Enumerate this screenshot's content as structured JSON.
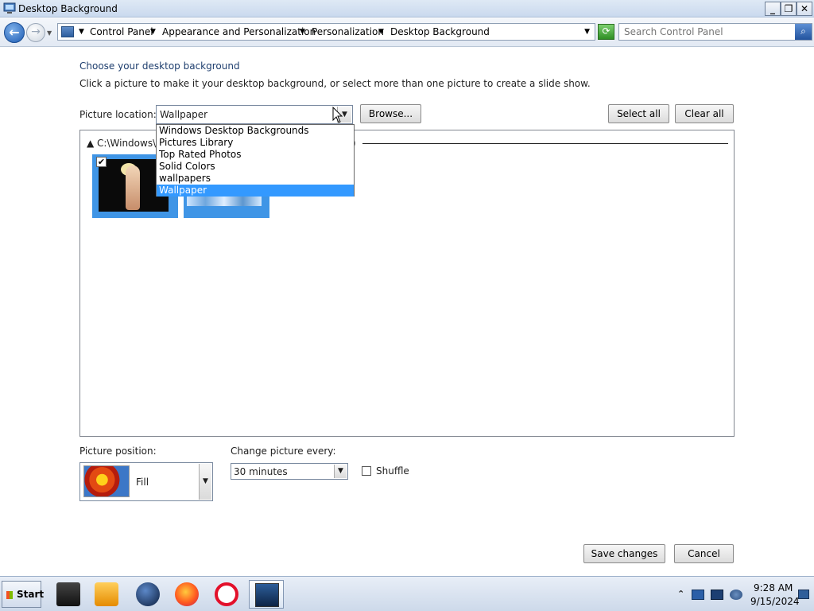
{
  "window": {
    "title": "Desktop Background",
    "minimize_glyph": "_",
    "restore_glyph": "❐",
    "close_glyph": "✕"
  },
  "nav": {
    "breadcrumbs": [
      "Control Panel",
      "Appearance and Personalization",
      "Personalization",
      "Desktop Background"
    ],
    "search_placeholder": "Search Control Panel"
  },
  "content": {
    "heading": "Choose your desktop background",
    "subtext": "Click a picture to make it your desktop background, or select more than one picture to create a slide show.",
    "picture_location_label": "Picture location:",
    "picture_location_value": "Wallpaper",
    "browse_label": "Browse...",
    "select_all_label": "Select all",
    "clear_all_label": "Clear all",
    "location_options": [
      "Windows Desktop Backgrounds",
      "Pictures Library",
      "Top Rated Photos",
      "Solid Colors",
      "wallpapers",
      "Wallpaper"
    ],
    "selected_option_index": 5,
    "group_header": "C:\\Windows\\F",
    "group_header_suffix": ")",
    "thumbnails": [
      {
        "checked": true
      },
      {
        "checked": false
      }
    ]
  },
  "settings": {
    "picture_position_label": "Picture position:",
    "picture_position_value": "Fill",
    "change_every_label": "Change picture every:",
    "change_every_value": "30 minutes",
    "shuffle_label": "Shuffle",
    "shuffle_checked": false
  },
  "footer": {
    "save_label": "Save changes",
    "cancel_label": "Cancel"
  },
  "taskbar": {
    "start_label": "Start",
    "apps": [
      "box-app-icon",
      "media-player-icon",
      "globe-icon",
      "firefox-icon",
      "opera-icon",
      "window-icon"
    ],
    "time": "9:28 AM",
    "date": "9/15/2024"
  }
}
